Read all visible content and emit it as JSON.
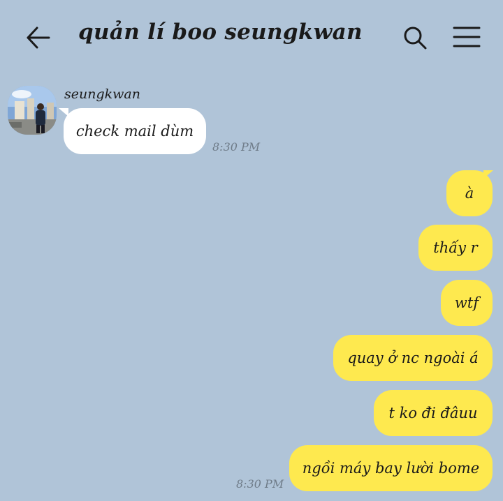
{
  "header": {
    "title": "quản lí boo seungkwan",
    "back_icon": "arrow-left-icon",
    "search_icon": "search-icon",
    "menu_icon": "hamburger-menu-icon"
  },
  "colors": {
    "background": "#B0C4D8",
    "incoming_bubble": "#FFFFFF",
    "outgoing_bubble": "#FEE94F"
  },
  "incoming": {
    "sender": "seungkwan",
    "message": "check mail dùm",
    "time": "8:30 PM"
  },
  "outgoing": {
    "messages": [
      "à",
      "thấy r",
      "wtf",
      "quay ở nc ngoài á",
      "t ko đi đâuu",
      "ngồi máy bay lười bome"
    ],
    "time": "8:30 PM"
  }
}
